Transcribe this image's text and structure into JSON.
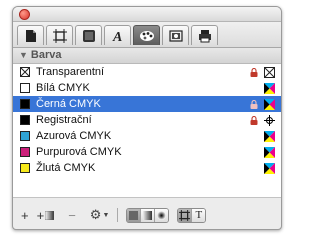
{
  "panel": {
    "section_title": "Barva",
    "tabs": [
      {
        "icon": "page-icon"
      },
      {
        "icon": "frame-icon"
      },
      {
        "icon": "box-icon"
      },
      {
        "icon": "character-icon"
      },
      {
        "icon": "colors-icon",
        "active": true
      },
      {
        "icon": "image-icon"
      },
      {
        "icon": "printer-icon"
      }
    ],
    "colors": [
      {
        "name": "Transparentní",
        "swatch": "none",
        "locked": true,
        "type": "none"
      },
      {
        "name": "Bílá CMYK",
        "swatch": "#ffffff",
        "locked": false,
        "type": "cmyk"
      },
      {
        "name": "Černá CMYK",
        "swatch": "#000000",
        "locked": true,
        "type": "cmyk",
        "selected": true
      },
      {
        "name": "Registrační",
        "swatch": "#000000",
        "locked": true,
        "type": "registration"
      },
      {
        "name": "Azurová CMYK",
        "swatch": "#2fa4d6",
        "locked": false,
        "type": "cmyk"
      },
      {
        "name": "Purpurová CMYK",
        "swatch": "#cc1f7a",
        "locked": false,
        "type": "cmyk"
      },
      {
        "name": "Žlutá CMYK",
        "swatch": "#f7ea1c",
        "locked": false,
        "type": "cmyk"
      }
    ]
  },
  "bottom": {
    "add_label": "+",
    "add_solid_label": "+",
    "remove_label": "−",
    "text_mode_label": "T"
  },
  "colors": {
    "selection": "#3875d7",
    "cyan": "#00aeef",
    "magenta": "#ec008c",
    "yellow": "#fff200",
    "black": "#000000"
  }
}
